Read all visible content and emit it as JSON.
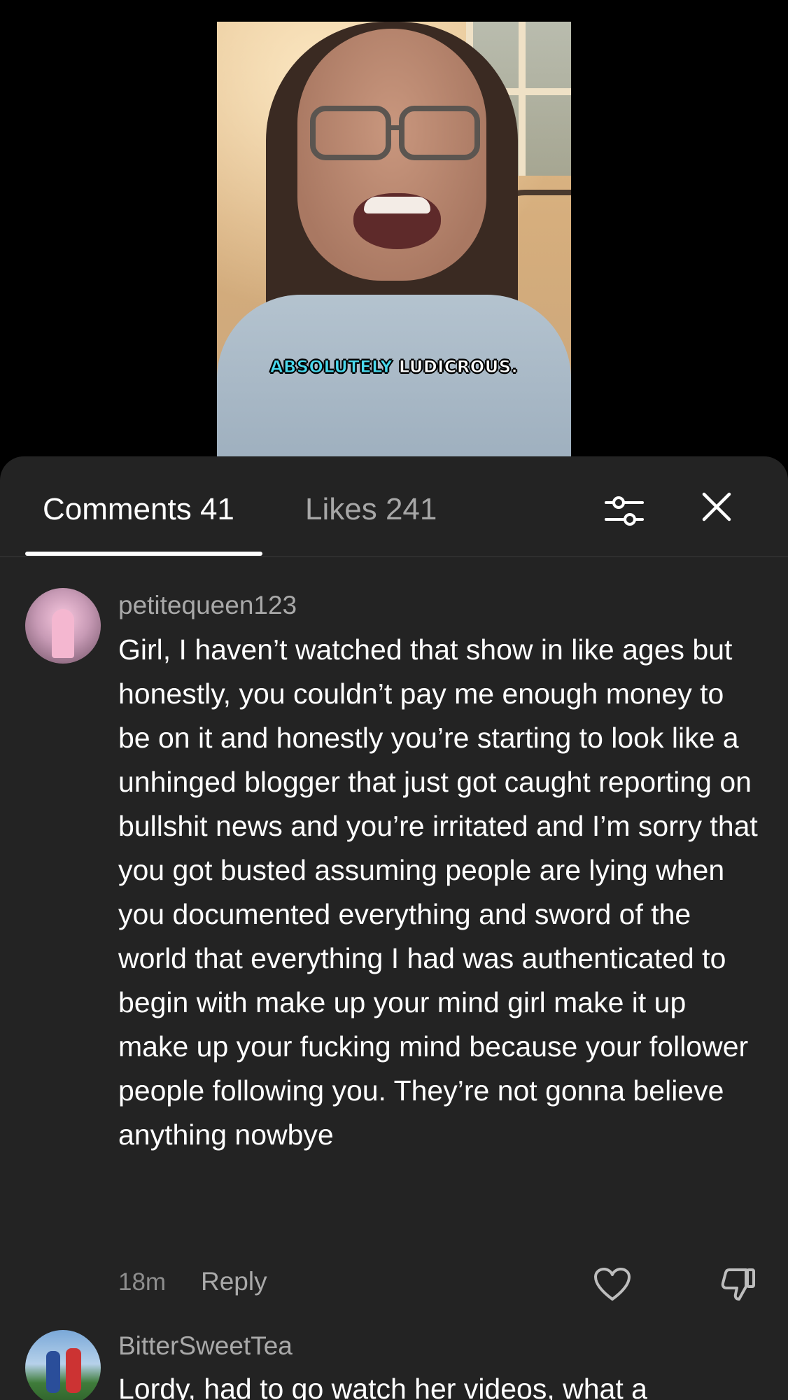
{
  "video": {
    "caption_highlight": "ABSOLUTELY",
    "caption_rest": "LUDICROUS."
  },
  "tabs": {
    "comments_label": "Comments 41",
    "likes_label": "Likes 241"
  },
  "icons": {
    "filter": "sliders-icon",
    "close": "close-icon",
    "like": "heart-icon",
    "dislike": "thumbs-down-icon"
  },
  "colors": {
    "sheet_bg": "#232323",
    "caption_accent": "#4ad9ee",
    "muted_text": "#a9a9a9"
  },
  "comments": [
    {
      "username": "petitequeen123",
      "text": "Girl, I haven’t watched that show in like ages but honestly, you couldn’t pay me enough money to be on it and honestly you’re starting to look like a unhinged blogger that just got caught reporting on bullshit news and you’re irritated and I’m sorry that you got busted assuming people are lying when you documented everything and sword of the world that everything I had was authenticated to begin with make up your mind girl make it up make up your fucking mind because your follower people following you. They’re not gonna believe anything nowbye",
      "time": "18m",
      "reply_label": "Reply"
    },
    {
      "username": "BitterSweetTea",
      "text": "Lordy, had to go watch her videos, what a"
    }
  ]
}
